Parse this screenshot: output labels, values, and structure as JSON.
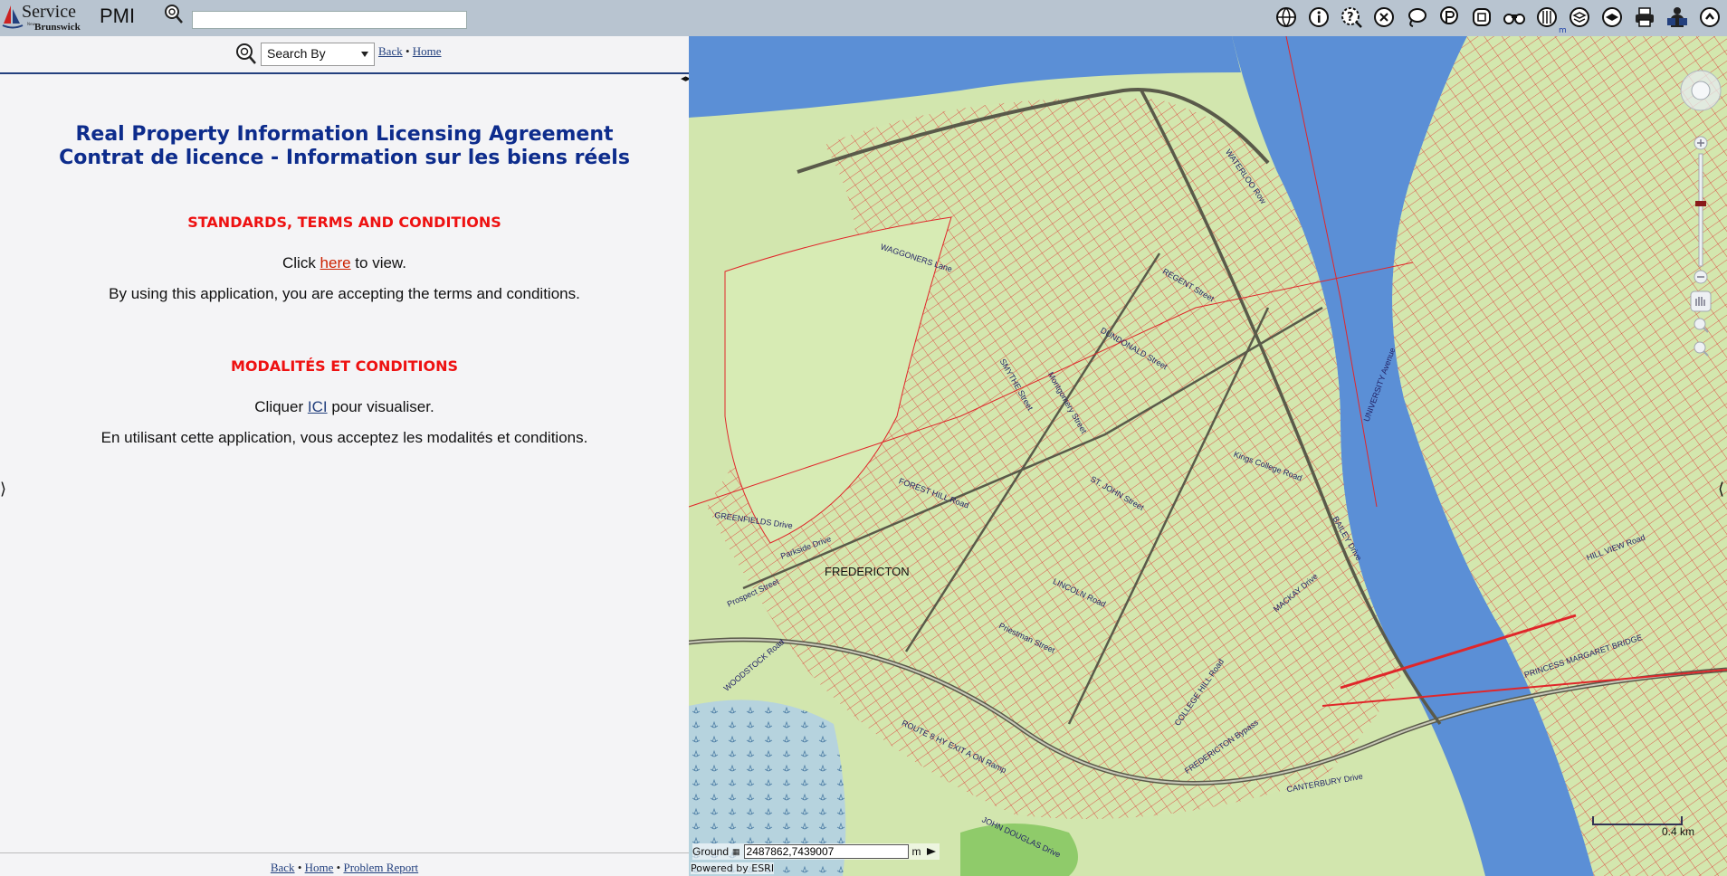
{
  "header": {
    "logo_main": "Service",
    "logo_sub": "Brunswick",
    "logo_tiny": "New",
    "app_name": "PMI",
    "search_placeholder": "",
    "search_value": "",
    "tools": [
      {
        "name": "globe-icon"
      },
      {
        "name": "info-icon"
      },
      {
        "name": "identify-icon"
      },
      {
        "name": "clear-icon"
      },
      {
        "name": "lasso-select-icon"
      },
      {
        "name": "pin-icon"
      },
      {
        "name": "zoom-extent-icon"
      },
      {
        "name": "binoculars-icon"
      },
      {
        "name": "measure-icon"
      },
      {
        "name": "layers-icon"
      },
      {
        "name": "basemap-icon"
      },
      {
        "name": "print-icon"
      },
      {
        "name": "help-icon"
      },
      {
        "name": "collapse-icon"
      }
    ],
    "tiny_m": "m"
  },
  "left": {
    "searchby_label": "Search By",
    "back_label": "Back",
    "sep": "•",
    "home_label": "Home",
    "title_en": "Real Property Information Licensing Agreement",
    "title_fr": "Contrat de licence - Information sur les biens réels",
    "sec_en": "STANDARDS, TERMS AND CONDITIONS",
    "click_pre": "Click ",
    "click_link": "here",
    "click_post": " to view.",
    "accept_en": "By using this application, you are accepting the terms and conditions.",
    "sec_fr": "MODALITÉS ET CONDITIONS",
    "cliquer_pre": "Cliquer ",
    "cliquer_link": "ICI",
    "cliquer_post": " pour visualiser.",
    "accept_fr": "En utilisant cette application, vous acceptez les modalités et conditions.",
    "footer": {
      "back": "Back",
      "home": "Home",
      "problem": "Problem Report",
      "sep": "•"
    }
  },
  "map": {
    "city_label": "FREDERICTON",
    "streets": [
      "GREENFIELDS Drive",
      "Parkside Drive",
      "FOREST HILL Road",
      "SMYTHE Street",
      "Montgomery Street",
      "WAGGONERS Lane",
      "DUNDONALD Street",
      "ST. JOHN Street",
      "REGENT Street",
      "PRINCESS MARGARET BRIDGE",
      "MACKAY Drive",
      "COLLEGE HILL Road",
      "FREDERICTON Bypass",
      "BAILEY Drive",
      "HILL VIEW Road",
      "JOHN DOUGLAS Drive",
      "ROUTE 8 HY EXIT A ON Ramp",
      "LINCOLN Road",
      "Priestman Street",
      "WOODSTOCK Road",
      "Prospect Street",
      "CANTERBURY Drive",
      "WATERLOO Row",
      "UNIVERSITY Avenue",
      "Kings College Road"
    ],
    "ground_label": "Ground",
    "coords_value": "2487862,7439007",
    "unit": "m",
    "powered": "Powered by ESRI",
    "scale": "0.4 km",
    "colors": {
      "water": "#5b8fd6",
      "land": "#d2e6ae",
      "parcel": "#e0262a",
      "road": "#5a5a4a",
      "green": "#b7d48e"
    }
  }
}
